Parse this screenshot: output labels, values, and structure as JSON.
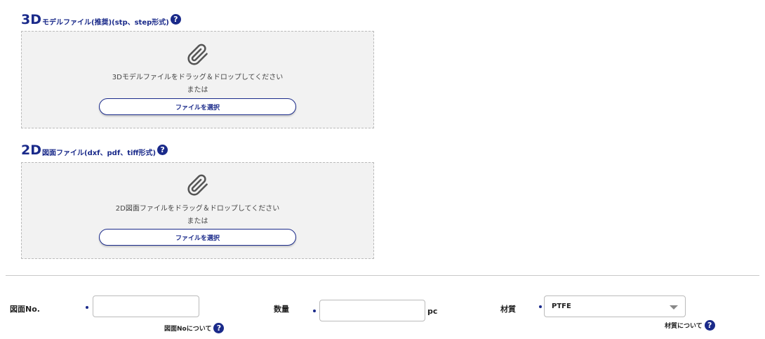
{
  "model_section": {
    "prefix": "3D",
    "title": "モデルファイル(推奨)(stp、step形式)",
    "drop_text": "3Dモデルファイルをドラッグ＆ドロップしてください",
    "or_text": "または",
    "button_label": "ファイルを選択"
  },
  "drawing_section": {
    "prefix": "2D",
    "title": "図面ファイル(dxf、pdf、tiff形式)",
    "drop_text": "2D図面ファイルをドラッグ＆ドロップしてください",
    "or_text": "または",
    "button_label": "ファイルを選択"
  },
  "help_glyph": "?",
  "form": {
    "drawing_no": {
      "label": "図面No.",
      "value": "",
      "help_link": "図面Noについて"
    },
    "quantity": {
      "label": "数量",
      "value": "",
      "unit": "pc"
    },
    "material": {
      "label": "材質",
      "selected": "PTFE",
      "help_link": "材質について"
    }
  },
  "colors": {
    "accent": "#1a2a8a",
    "dropzone_bg": "#f2f2f2"
  },
  "icons": {
    "attach": "paperclip-icon",
    "help": "question-circle-icon",
    "select": "caret-down-icon"
  }
}
